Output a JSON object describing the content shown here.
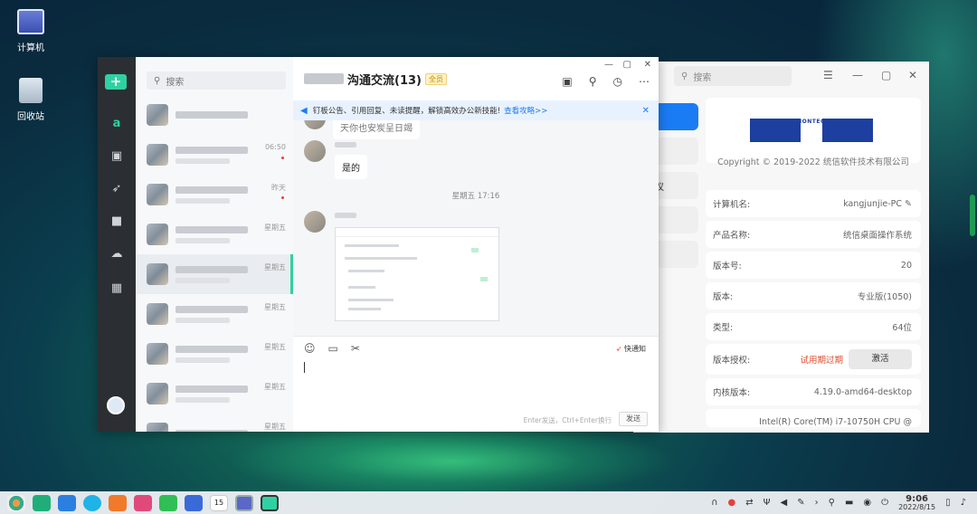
{
  "desktop": {
    "icons": [
      {
        "label": "计算机"
      },
      {
        "label": "回收站"
      }
    ]
  },
  "chat": {
    "search_placeholder": "搜索",
    "group_title": "沟通交流(13)",
    "all_tag": "全员",
    "notice_text": "钉板公告、引用回复、未读提醒，解锁高效办公新技能!",
    "notice_link": "查看攻略>>",
    "conversations": [
      {
        "time": ""
      },
      {
        "time": "06:50",
        "unread": true
      },
      {
        "time": "昨天",
        "unread": true
      },
      {
        "time": "星期五"
      },
      {
        "time": "星期五"
      },
      {
        "time": "星期五"
      },
      {
        "time": "星期五"
      },
      {
        "time": "星期五"
      },
      {
        "time": "星期五"
      }
    ],
    "messages": {
      "partial_text": "天你也安炭呈日竭",
      "reply_text": "是的",
      "timestamp": "星期五 17:16"
    },
    "composer": {
      "notify_label": "快通知",
      "hint": "Enter发送，Ctrl+Enter换行",
      "send_label": "发送"
    }
  },
  "sysinfo": {
    "search_placeholder": "搜索",
    "left_item": "议",
    "logo_text": "UNIONTECH",
    "copyright": "Copyright © 2019-2022 统信软件技术有限公司",
    "rows": [
      {
        "label": "计算机名:",
        "value": "kangjunjie-PC"
      },
      {
        "label": "产品名称:",
        "value": "统信桌面操作系统"
      },
      {
        "label": "版本号:",
        "value": "20"
      },
      {
        "label": "版本:",
        "value": "专业版(1050)"
      },
      {
        "label": "类型:",
        "value": "64位"
      }
    ],
    "license_label": "版本授权:",
    "license_status": "试用期过期",
    "activate_label": "激活",
    "kernel_label": "内核版本:",
    "kernel_value": "4.19.0-amd64-desktop",
    "cpu_value": "Intel(R) Core(TM) i7-10750H CPU @"
  },
  "taskbar": {
    "time": "9:06",
    "date": "2022/8/15",
    "calendar_day": "15"
  },
  "colors": {
    "accent": "#2fd1a2",
    "blue": "#1a7cf5",
    "warning": "#e04a2a"
  }
}
